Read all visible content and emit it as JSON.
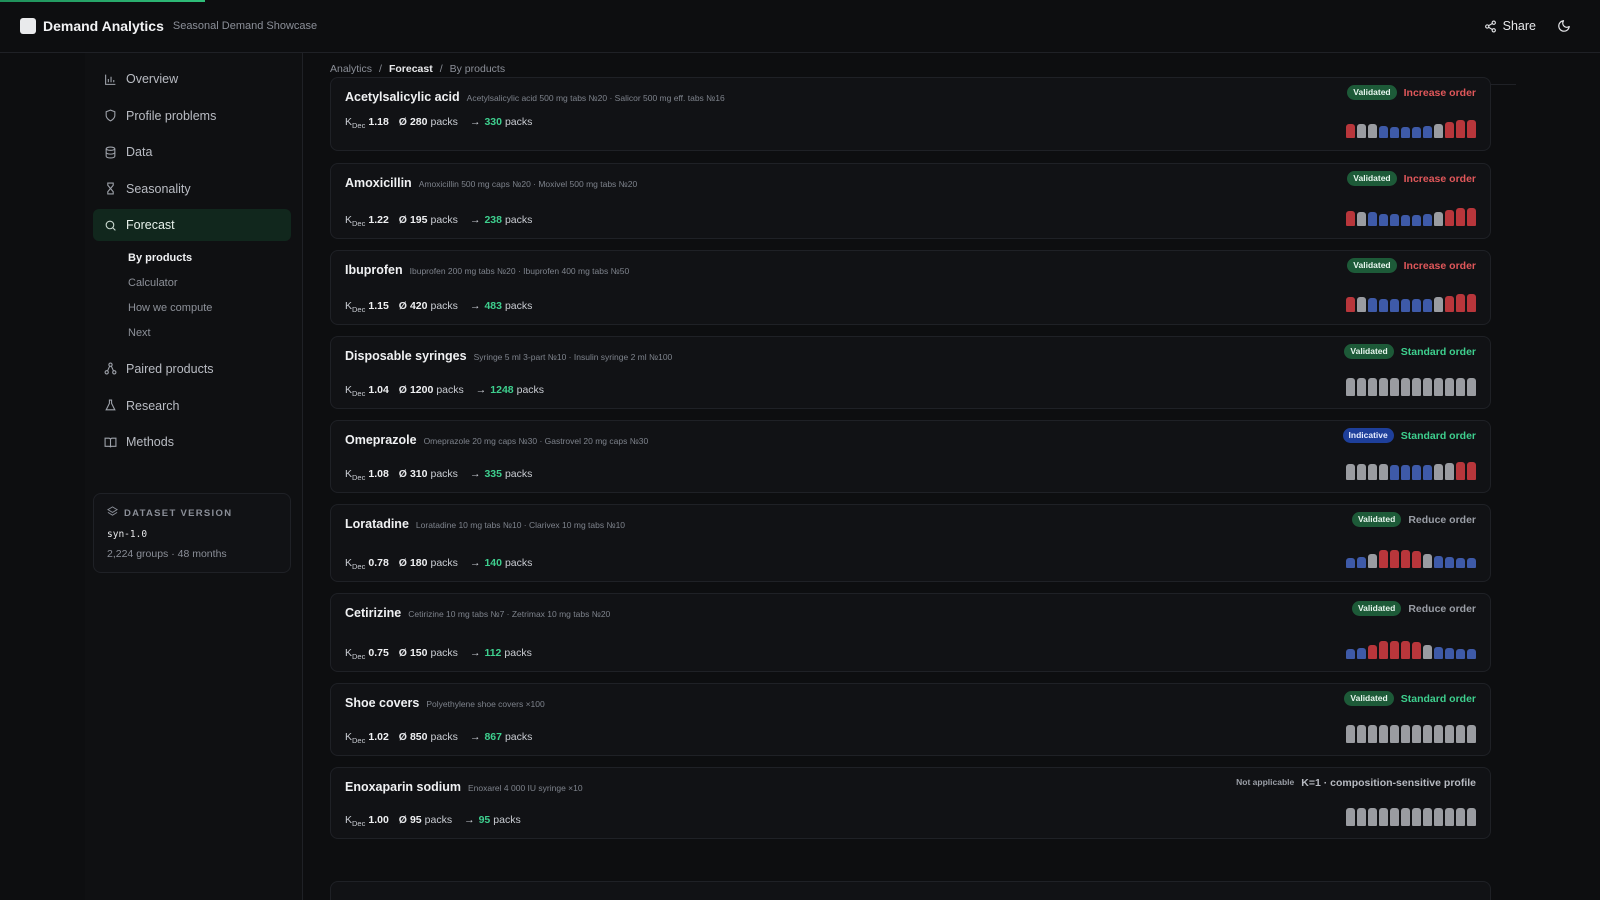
{
  "app": {
    "title": "Demand Analytics",
    "subtitle": "Seasonal Demand Showcase",
    "share_label": "Share",
    "icons": {
      "logo": "logo-square",
      "share": "share-icon",
      "theme": "moon-icon"
    }
  },
  "sidebar": {
    "items": [
      {
        "label": "Overview",
        "icon": "bar-chart-icon"
      },
      {
        "label": "Profile problems",
        "icon": "shield-icon"
      },
      {
        "label": "Data",
        "icon": "database-icon"
      },
      {
        "label": "Seasonality",
        "icon": "hourglass-icon"
      },
      {
        "label": "Forecast",
        "icon": "search-icon",
        "active": true
      },
      {
        "label": "Paired products",
        "icon": "network-icon"
      },
      {
        "label": "Research",
        "icon": "flask-icon"
      },
      {
        "label": "Methods",
        "icon": "book-icon"
      }
    ],
    "forecast_sub": [
      "By products",
      "Calculator",
      "How we compute",
      "Next"
    ],
    "dataset": {
      "heading": "DATASET VERSION",
      "version": "syn-1.0",
      "meta": "2,224 groups · 48 months",
      "icon": "layers-icon"
    }
  },
  "breadcrumb": [
    "Analytics",
    "Forecast",
    "By products"
  ],
  "k_label": "K",
  "k_sub": "Dec",
  "avg_symbol": "Ø",
  "unit": "packs",
  "arrow": "→",
  "colors": {
    "red": "#b8363b",
    "blue": "#3e5aa8",
    "gray": "#9a9ca1",
    "green": "#3ecf8e",
    "validated": "#1d5a38",
    "indicative": "#1e3f9a"
  },
  "products": [
    {
      "name": "Acetylsalicylic acid",
      "desc": "Acetylsalicylic acid 500 mg tabs №20 · Salicor 500 mg eff. tabs №16",
      "k": "1.18",
      "avg": "280",
      "forecast": "330",
      "badge": "Validated",
      "badge_type": "validated",
      "rec": "Increase order",
      "rec_type": "increase",
      "bars": [
        "red",
        "gray",
        "gray",
        "blue",
        "blue",
        "blue",
        "blue",
        "blue",
        "gray",
        "red",
        "red",
        "red"
      ],
      "levels": [
        0.8,
        0.8,
        0.75,
        0.65,
        0.6,
        0.6,
        0.6,
        0.65,
        0.8,
        0.9,
        1.0,
        1.0
      ]
    },
    {
      "name": "Amoxicillin",
      "desc": "Amoxicillin 500 mg caps №20 · Moxivel 500 mg tabs №20",
      "k": "1.22",
      "avg": "195",
      "forecast": "238",
      "badge": "Validated",
      "badge_type": "validated",
      "rec": "Increase order",
      "rec_type": "increase",
      "bars": [
        "red",
        "gray",
        "blue",
        "blue",
        "blue",
        "blue",
        "blue",
        "blue",
        "gray",
        "red",
        "red",
        "red"
      ],
      "levels": [
        0.85,
        0.8,
        0.75,
        0.65,
        0.65,
        0.6,
        0.6,
        0.65,
        0.8,
        0.9,
        1.0,
        1.0
      ]
    },
    {
      "name": "Ibuprofen",
      "desc": "Ibuprofen 200 mg tabs №20 · Ibuprofen 400 mg tabs №50",
      "k": "1.15",
      "avg": "420",
      "forecast": "483",
      "badge": "Validated",
      "badge_type": "validated",
      "rec": "Increase order",
      "rec_type": "increase",
      "bars": [
        "red",
        "gray",
        "blue",
        "blue",
        "blue",
        "blue",
        "blue",
        "blue",
        "gray",
        "red",
        "red",
        "red"
      ],
      "levels": [
        0.85,
        0.85,
        0.8,
        0.7,
        0.7,
        0.7,
        0.7,
        0.7,
        0.85,
        0.9,
        1.0,
        1.0
      ]
    },
    {
      "name": "Disposable syringes",
      "desc": "Syringe 5 ml 3-part №10 · Insulin syringe 2 ml №100",
      "k": "1.04",
      "avg": "1200",
      "forecast": "1248",
      "badge": "Validated",
      "badge_type": "validated",
      "rec": "Standard order",
      "rec_type": "standard",
      "bars": [
        "gray",
        "gray",
        "gray",
        "gray",
        "gray",
        "gray",
        "gray",
        "gray",
        "gray",
        "gray",
        "gray",
        "gray"
      ],
      "levels": [
        1,
        1,
        1,
        1,
        1,
        1,
        1,
        1,
        1,
        1,
        1,
        1
      ]
    },
    {
      "name": "Omeprazole",
      "desc": "Omeprazole 20 mg caps №30 · Gastrovel 20 mg caps №30",
      "k": "1.08",
      "avg": "310",
      "forecast": "335",
      "badge": "Indicative",
      "badge_type": "indicative",
      "rec": "Standard order",
      "rec_type": "standard",
      "bars": [
        "gray",
        "gray",
        "gray",
        "gray",
        "blue",
        "blue",
        "blue",
        "blue",
        "gray",
        "gray",
        "red",
        "red"
      ],
      "levels": [
        0.9,
        0.9,
        0.9,
        0.9,
        0.85,
        0.85,
        0.85,
        0.85,
        0.9,
        0.95,
        1.0,
        1.0
      ]
    },
    {
      "name": "Loratadine",
      "desc": "Loratadine 10 mg tabs №10 · Clarivex 10 mg tabs №10",
      "k": "0.78",
      "avg": "180",
      "forecast": "140",
      "badge": "Validated",
      "badge_type": "validated",
      "rec": "Reduce order",
      "rec_type": "reduce",
      "bars": [
        "blue",
        "blue",
        "gray",
        "red",
        "red",
        "red",
        "red",
        "gray",
        "blue",
        "blue",
        "blue",
        "blue"
      ],
      "levels": [
        0.55,
        0.6,
        0.8,
        1.0,
        1.0,
        1.0,
        0.95,
        0.8,
        0.65,
        0.6,
        0.55,
        0.55
      ]
    },
    {
      "name": "Cetirizine",
      "desc": "Cetirizine 10 mg tabs №7 · Zetrimax 10 mg tabs №20",
      "k": "0.75",
      "avg": "150",
      "forecast": "112",
      "badge": "Validated",
      "badge_type": "validated",
      "rec": "Reduce order",
      "rec_type": "reduce",
      "bars": [
        "blue",
        "blue",
        "red",
        "red",
        "red",
        "red",
        "red",
        "gray",
        "blue",
        "blue",
        "blue",
        "blue"
      ],
      "levels": [
        0.55,
        0.6,
        0.8,
        1.0,
        1.0,
        1.0,
        0.95,
        0.8,
        0.65,
        0.6,
        0.55,
        0.55
      ]
    },
    {
      "name": "Shoe covers",
      "desc": "Polyethylene shoe covers ×100",
      "k": "1.02",
      "avg": "850",
      "forecast": "867",
      "badge": "Validated",
      "badge_type": "validated",
      "rec": "Standard order",
      "rec_type": "standard",
      "bars": [
        "gray",
        "gray",
        "gray",
        "gray",
        "gray",
        "gray",
        "gray",
        "gray",
        "gray",
        "gray",
        "gray",
        "gray"
      ],
      "levels": [
        1,
        1,
        1,
        1,
        1,
        1,
        1,
        1,
        1,
        1,
        1,
        1
      ]
    },
    {
      "name": "Enoxaparin sodium",
      "desc": "Enoxarel 4 000 IU syringe ×10",
      "k": "1.00",
      "avg": "95",
      "forecast": "95",
      "badge": "Not applicable",
      "badge_type": "na",
      "rec": "K=1 · composition-sensitive profile",
      "rec_type": "neutral",
      "bars": [
        "gray",
        "gray",
        "gray",
        "gray",
        "gray",
        "gray",
        "gray",
        "gray",
        "gray",
        "gray",
        "gray",
        "gray"
      ],
      "levels": [
        1,
        1,
        1,
        1,
        1,
        1,
        1,
        1,
        1,
        1,
        1,
        1
      ]
    }
  ]
}
